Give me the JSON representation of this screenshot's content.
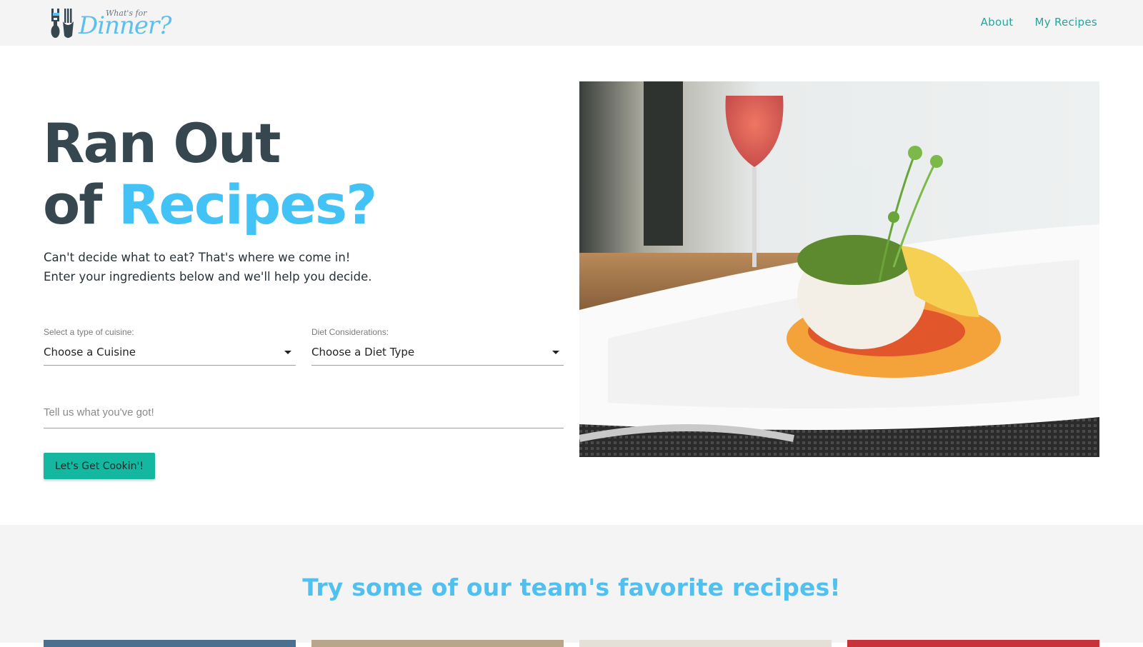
{
  "navbar": {
    "logo": {
      "small_text": "What's for",
      "big_text": "Dinner?"
    },
    "links": [
      {
        "label": "About"
      },
      {
        "label": "My Recipes"
      }
    ]
  },
  "hero": {
    "title_line1": "Ran Out",
    "title_line2_prefix": "of",
    "title_line2_accent": "Recipes?",
    "subtitle_line1": "Can't decide what to eat? That's where we come in!",
    "subtitle_line2": "Enter your ingredients below and we'll help you decide."
  },
  "form": {
    "cuisine_label": "Select a type of cuisine:",
    "cuisine_value": "Choose a Cuisine",
    "diet_label": "Diet Considerations:",
    "diet_value": "Choose a Diet Type",
    "ingredients_placeholder": "Tell us what you've got!",
    "submit_label": "Let's Get Cookin'!"
  },
  "favorites": {
    "title": "Try some of our team's favorite recipes!"
  },
  "colors": {
    "accent_blue": "#42c2f5",
    "accent_teal": "#14b8a0",
    "nav_link": "#26a69a",
    "heading_dark": "#37474f"
  }
}
